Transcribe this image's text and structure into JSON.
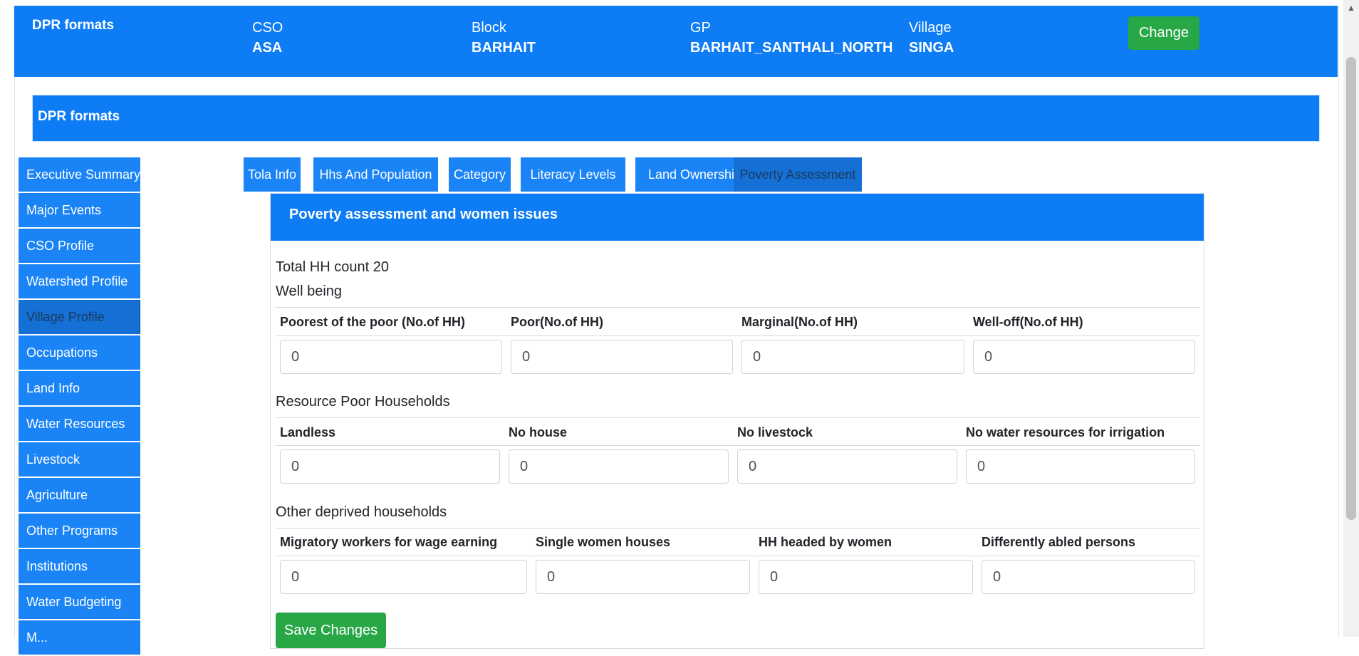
{
  "topbar": {
    "brand": "DPR formats",
    "cso": {
      "label": "CSO",
      "value": "ASA"
    },
    "block": {
      "label": "Block",
      "value": "BARHAIT"
    },
    "gp": {
      "label": "GP",
      "value": "BARHAIT_SANTHALI_NORTH"
    },
    "village": {
      "label": "Village",
      "value": "SINGA"
    },
    "change_label": "Change"
  },
  "section_title": "DPR formats",
  "sidebar": {
    "active": "Village Profile",
    "items": [
      {
        "label": "Executive Summary"
      },
      {
        "label": "Major Events"
      },
      {
        "label": "CSO Profile"
      },
      {
        "label": "Watershed Profile"
      },
      {
        "label": "Village Profile"
      },
      {
        "label": "Occupations"
      },
      {
        "label": "Land Info"
      },
      {
        "label": "Water Resources"
      },
      {
        "label": "Livestock"
      },
      {
        "label": "Agriculture"
      },
      {
        "label": "Other Programs"
      },
      {
        "label": "Institutions"
      },
      {
        "label": "Water Budgeting"
      },
      {
        "label": "M..."
      }
    ]
  },
  "tabs": {
    "active": "Poverty Assessment",
    "items": [
      {
        "label": "Tola Info"
      },
      {
        "label": "Hhs And Population"
      },
      {
        "label": "Category"
      },
      {
        "label": "Literacy Levels"
      },
      {
        "label": "Land Ownership"
      },
      {
        "label": "Poverty Assessment"
      }
    ]
  },
  "card": {
    "title": "Poverty assessment and women issues",
    "total_hh": "Total HH count 20",
    "well_being": {
      "heading": "Well being",
      "columns": [
        "Poorest of the poor (No.of HH)",
        "Poor(No.of HH)",
        "Marginal(No.of HH)",
        "Well-off(No.of HH)"
      ],
      "values": [
        "0",
        "0",
        "0",
        "0"
      ]
    },
    "resource_poor": {
      "heading": "Resource Poor Households",
      "columns": [
        "Landless",
        "No house",
        "No livestock",
        "No water resources for irrigation"
      ],
      "values": [
        "0",
        "0",
        "0",
        "0"
      ]
    },
    "other_deprived": {
      "heading": "Other deprived households",
      "columns": [
        "Migratory workers for wage earning",
        "Single women houses",
        "HH headed by women",
        "Differently abled persons"
      ],
      "values": [
        "0",
        "0",
        "0",
        "0"
      ]
    },
    "save_label": "Save Changes"
  }
}
